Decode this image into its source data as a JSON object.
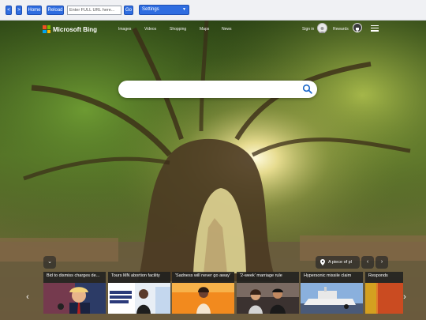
{
  "browser": {
    "back_label": "<",
    "forward_label": ">",
    "home_label": "Home",
    "reload_label": "Reload",
    "url_placeholder": "Enter FULL URL here...",
    "go_label": "Go",
    "settings_label": "Settings"
  },
  "header": {
    "logo_text": "Microsoft Bing",
    "nav": [
      "Images",
      "Videos",
      "Shopping",
      "Maps",
      "News"
    ],
    "signin_label": "Sign in",
    "rewards_label": "Rewards"
  },
  "search": {
    "value": "",
    "placeholder": ""
  },
  "image_info": {
    "label": "A piece of pl"
  },
  "controls": {
    "collapse_label": "⌄",
    "prev_label": "‹",
    "next_label": "›"
  },
  "news": [
    {
      "title": "Bid to dismiss charges de..."
    },
    {
      "title": "Tours MN abortion facility"
    },
    {
      "title": "'Sadness will never go away'"
    },
    {
      "title": "'2-week' marriage rule"
    },
    {
      "title": "Hypersonic missile claim"
    },
    {
      "title": "Responds"
    }
  ],
  "news_thumb_text": "FIGHT REPRODUCTIVE FREEDOM",
  "colors": {
    "accent": "#2f6de0",
    "ms_red": "#f25022",
    "ms_green": "#7fba00",
    "ms_blue": "#00a4ef",
    "ms_yellow": "#ffb900"
  },
  "icons": {
    "search": "magnifier",
    "location": "pin",
    "menu": "hamburger",
    "rewards": "trophy-badge"
  }
}
